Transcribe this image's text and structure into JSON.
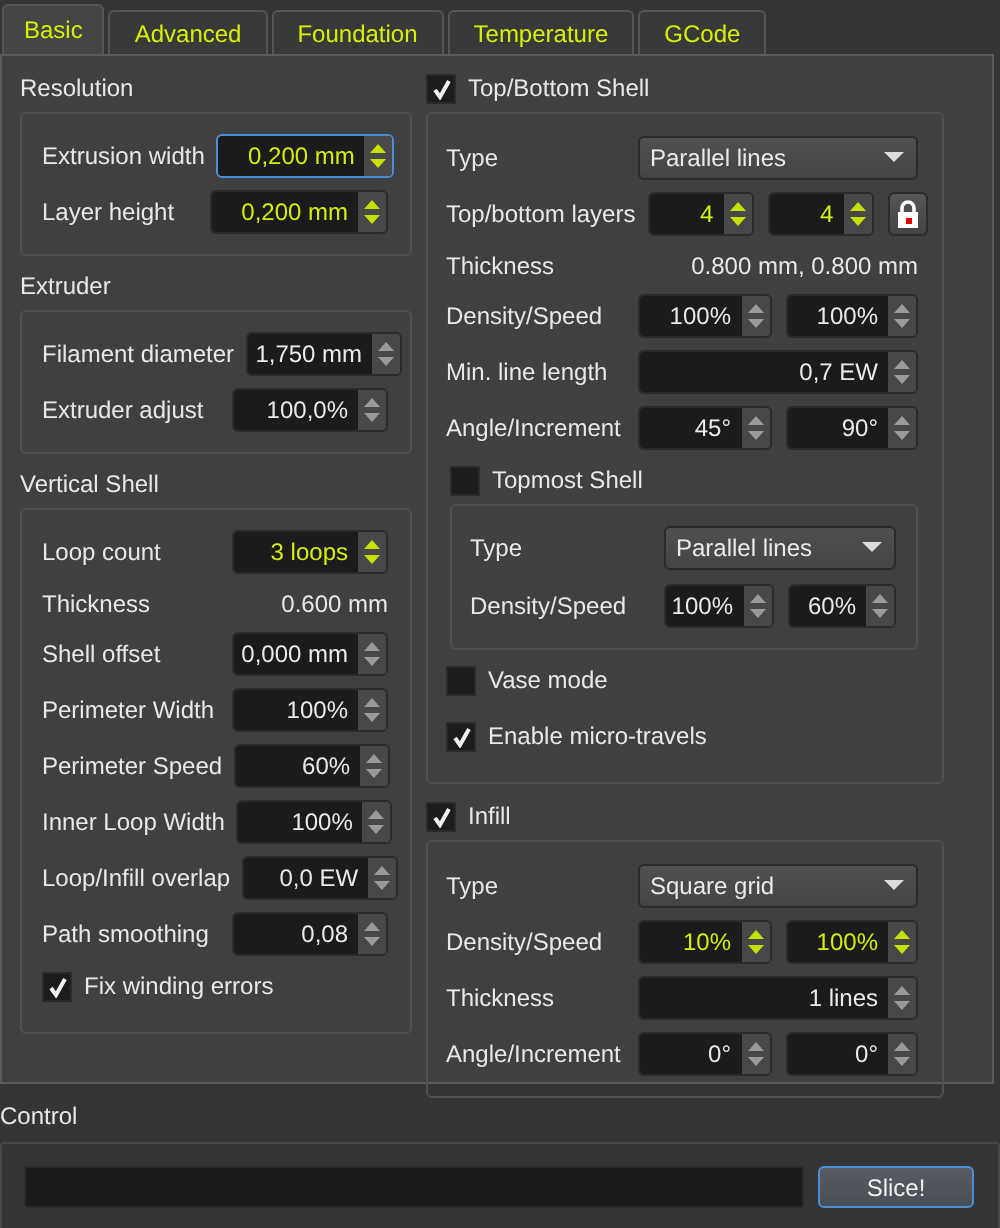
{
  "tabs": [
    {
      "label": "Basic",
      "selected": true
    },
    {
      "label": "Advanced",
      "selected": false
    },
    {
      "label": "Foundation",
      "selected": false
    },
    {
      "label": "Temperature",
      "selected": false
    },
    {
      "label": "GCode",
      "selected": false
    }
  ],
  "left_groups": [
    {
      "title": "Resolution",
      "rows": [
        {
          "kind": "spin",
          "label": "Extrusion width",
          "value": "0,200 mm",
          "modified": true,
          "focused": true
        },
        {
          "kind": "spin",
          "label": "Layer height",
          "value": "0,200 mm",
          "modified": true,
          "focused": false
        }
      ]
    },
    {
      "title": "Extruder",
      "rows": [
        {
          "kind": "spin",
          "label": "Filament diameter",
          "value": "1,750 mm",
          "modified": false,
          "focused": false
        },
        {
          "kind": "spin",
          "label": "Extruder adjust",
          "value": "100,0%",
          "modified": false,
          "focused": false
        }
      ]
    },
    {
      "title": "Vertical Shell",
      "rows": [
        {
          "kind": "spin",
          "label": "Loop count",
          "value": "3 loops",
          "modified": true,
          "focused": false
        },
        {
          "kind": "reading",
          "label": "Thickness",
          "value": "0.600 mm"
        },
        {
          "kind": "spin",
          "label": "Shell offset",
          "value": "0,000 mm",
          "modified": false,
          "focused": false
        },
        {
          "kind": "spin",
          "label": "Perimeter Width",
          "value": "100%",
          "modified": false,
          "focused": false
        },
        {
          "kind": "spin",
          "label": "Perimeter Speed",
          "value": "60%",
          "modified": false,
          "focused": false
        },
        {
          "kind": "spin",
          "label": "Inner Loop Width",
          "value": "100%",
          "modified": false,
          "focused": false
        },
        {
          "kind": "spin",
          "label": "Loop/Infill overlap",
          "value": "0,0 EW",
          "modified": false,
          "focused": false
        },
        {
          "kind": "spin",
          "label": "Path smoothing",
          "value": "0,08",
          "modified": false,
          "focused": false
        },
        {
          "kind": "checkbox",
          "label": "Fix winding errors",
          "checked": true
        }
      ]
    }
  ],
  "right_groups": [
    {
      "title": "Top/Bottom Shell",
      "checked": true,
      "rows": [
        {
          "kind": "combo",
          "label": "Type",
          "value": "Parallel lines"
        },
        {
          "kind": "spin_pair",
          "label": "Top/bottom layers",
          "fields": [
            {
              "value": "4",
              "modified": true
            },
            {
              "value": "4",
              "modified": true
            }
          ],
          "locked": true
        },
        {
          "kind": "reading",
          "label": "Thickness",
          "value": "0.800 mm, 0.800 mm"
        },
        {
          "kind": "spin_pair",
          "label": "Density/Speed",
          "fields": [
            {
              "value": "100%",
              "modified": false
            },
            {
              "value": "100%",
              "modified": false
            }
          ]
        },
        {
          "kind": "spin",
          "label": "Min. line length",
          "value": "0,7 EW",
          "modified": false,
          "focused": false
        },
        {
          "kind": "spin_pair",
          "label": "Angle/Increment",
          "fields": [
            {
              "value": "45°",
              "modified": false
            },
            {
              "value": "90°",
              "modified": false
            }
          ]
        },
        {
          "kind": "subgroup",
          "title": "Topmost Shell",
          "checked": false,
          "rows": [
            {
              "kind": "combo",
              "label": "Type",
              "value": "Parallel lines"
            },
            {
              "kind": "spin_pair",
              "label": "Density/Speed",
              "fields": [
                {
                  "value": "100%",
                  "modified": false
                },
                {
                  "value": "60%",
                  "modified": false
                }
              ]
            }
          ]
        },
        {
          "kind": "checkbox",
          "label": "Vase mode",
          "checked": false
        },
        {
          "kind": "checkbox",
          "label": "Enable micro-travels",
          "checked": true
        }
      ]
    },
    {
      "title": "Infill",
      "checked": true,
      "rows": [
        {
          "kind": "combo",
          "label": "Type",
          "value": "Square grid"
        },
        {
          "kind": "spin_pair",
          "label": "Density/Speed",
          "fields": [
            {
              "value": "10%",
              "modified": true
            },
            {
              "value": "100%",
              "modified": true
            }
          ]
        },
        {
          "kind": "spin",
          "label": "Thickness",
          "value": "1 lines",
          "modified": false,
          "focused": false
        },
        {
          "kind": "spin_pair",
          "label": "Angle/Increment",
          "fields": [
            {
              "value": "0°",
              "modified": false
            },
            {
              "value": "0°",
              "modified": false
            }
          ]
        }
      ]
    }
  ],
  "control": {
    "title": "Control",
    "progress": {
      "level": 0
    },
    "button": "Slice!"
  }
}
